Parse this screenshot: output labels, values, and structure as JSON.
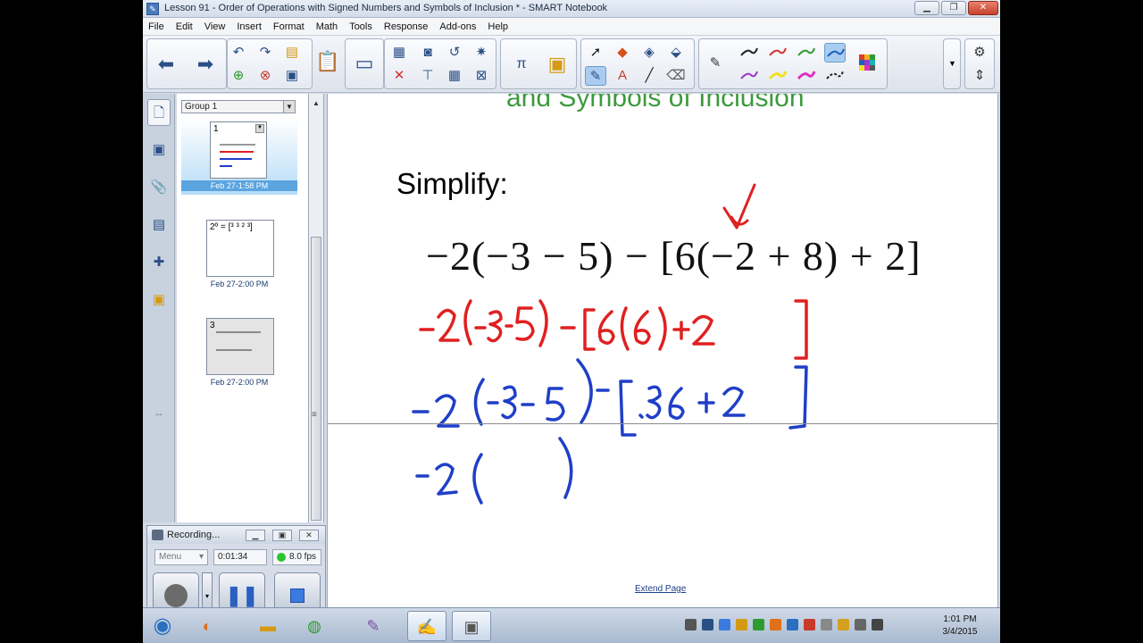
{
  "window": {
    "title": "Lesson 91 - Order of Operations with Signed Numbers and Symbols of Inclusion * - SMART Notebook",
    "icon": "notebook-icon",
    "controls": [
      "minimize-icon",
      "restore-icon",
      "close-icon"
    ]
  },
  "menu": [
    "File",
    "Edit",
    "View",
    "Insert",
    "Format",
    "Math",
    "Tools",
    "Response",
    "Add-ons",
    "Help"
  ],
  "toolbar": {
    "icons": [
      "back-arrow-icon",
      "forward-arrow-icon",
      "undo-icon",
      "redo-icon",
      "open-folder-icon",
      "add-page-icon",
      "delete-page-icon",
      "save-icon",
      "paste-icon",
      "screen-shade-icon",
      "document-camera-icon",
      "delete-icon",
      "capture-icon",
      "table-icon",
      "math-tools-icon",
      "add-ons-icon",
      "select-icon",
      "shapes-icon",
      "magic-pen-icon",
      "fill-icon",
      "pens-icon",
      "text-icon",
      "line-icon",
      "eraser-icon",
      "color-palette-icon",
      "settings-icon",
      "move-toolbar-icon"
    ],
    "selected_pen_color": "#1f5fc0"
  },
  "sidebar_tabs": [
    "page-sorter-icon",
    "gallery-icon",
    "attachments-icon",
    "properties-icon",
    "add-ons-icon",
    "lesson-activity-icon"
  ],
  "sorter": {
    "group": "Group 1",
    "pages": [
      {
        "num": "1",
        "date": "Feb 27-1:58 PM",
        "selected": true
      },
      {
        "num": "2",
        "snippet": "2º = [³ ³ ² ³]",
        "date": "Feb 27-2:00 PM",
        "selected": false
      },
      {
        "num": "3",
        "date": "Feb 27-2:00 PM",
        "selected": false
      }
    ]
  },
  "canvas": {
    "heading": "and Symbols of Inclusion",
    "prompt": "Simplify:",
    "expression": "−2(−3 − 5) − [6(−2 + 8) + 2]",
    "extend_link": "Extend Page",
    "ink_colors": {
      "red": "#e02020",
      "blue": "#1f3fc8"
    }
  },
  "recorder": {
    "title": "Recording...",
    "menu": "Menu",
    "time": "0:01:34",
    "fps": "8.0 fps"
  },
  "taskbar": {
    "apps": [
      "start-icon",
      "firefox-icon",
      "explorer-icon",
      "chrome-icon",
      "paint-icon",
      "smart-notebook-icon",
      "recorder-icon"
    ],
    "time": "1:01 PM",
    "date": "3/4/2015"
  }
}
